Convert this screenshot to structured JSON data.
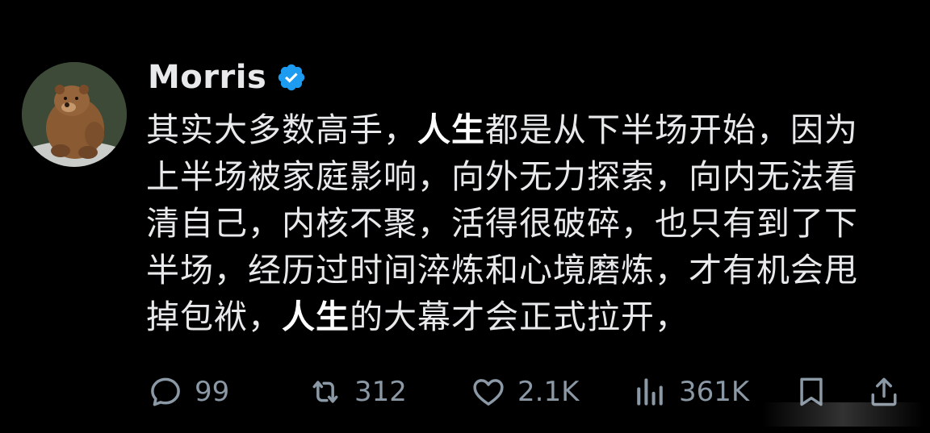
{
  "post": {
    "author": {
      "name": "Morris",
      "verified": true,
      "avatar_icon": "bear-avatar"
    },
    "text_lines": [
      [
        {
          "t": "其实大多数高手，",
          "b": false
        },
        {
          "t": "人生",
          "b": true
        },
        {
          "t": "都是从下半场开始，因为",
          "b": false
        }
      ],
      [
        {
          "t": "上半场被家庭影响，向外无力探索，向内无法看",
          "b": false
        }
      ],
      [
        {
          "t": "清自己，内核不聚，活得很破碎，也只有到了下",
          "b": false
        }
      ],
      [
        {
          "t": "半场，经历过时间淬炼和心境磨炼，才有机会甩",
          "b": false
        }
      ],
      [
        {
          "t": "掉包袱，",
          "b": false
        },
        {
          "t": "人生",
          "b": true
        },
        {
          "t": "的大幕才会正式拉开，",
          "b": false
        }
      ]
    ],
    "line1_a": "其实大多数高手，",
    "line1_b": "人生",
    "line1_c": "都是从下半场开始，因为",
    "line2": "上半场被家庭影响，向外无力探索，向内无法看",
    "line3": "清自己，内核不聚，活得很破碎，也只有到了下",
    "line4": "半场，经历过时间淬炼和心境磨炼，才有机会甩",
    "line5_a": "掉包袱，",
    "line5_b": "人生",
    "line5_c": "的大幕才会正式拉开，"
  },
  "actions": {
    "reply": {
      "icon": "reply-icon",
      "count": "99"
    },
    "repost": {
      "icon": "repost-icon",
      "count": "312"
    },
    "like": {
      "icon": "heart-icon",
      "count": "2.1K"
    },
    "views": {
      "icon": "views-icon",
      "count": "361K"
    },
    "bookmark": {
      "icon": "bookmark-icon"
    },
    "share": {
      "icon": "share-icon"
    }
  },
  "colors": {
    "background": "#000000",
    "text": "#e7e9ea",
    "muted": "#8b98a5",
    "verified": "#1d9bf0"
  }
}
